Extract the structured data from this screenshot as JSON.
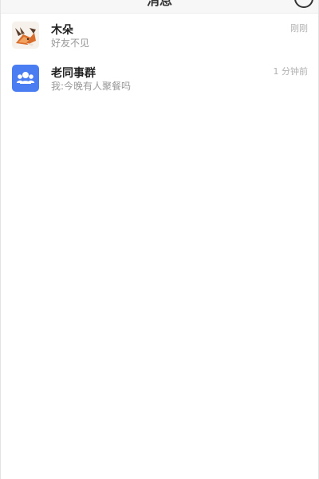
{
  "header": {
    "title": "消息"
  },
  "conversations": [
    {
      "name": "木朵",
      "preview": "好友不见",
      "time": "刚刚",
      "avatar": "fox-photo"
    },
    {
      "name": "老同事群",
      "preview": "我:今晚有人聚餐吗",
      "time": "1 分钟前",
      "avatar": "group-icon"
    }
  ],
  "colors": {
    "group_avatar": "#4a7cf2",
    "name_text": "#222222",
    "preview_text": "#999999",
    "time_text": "#b0b0b0"
  }
}
